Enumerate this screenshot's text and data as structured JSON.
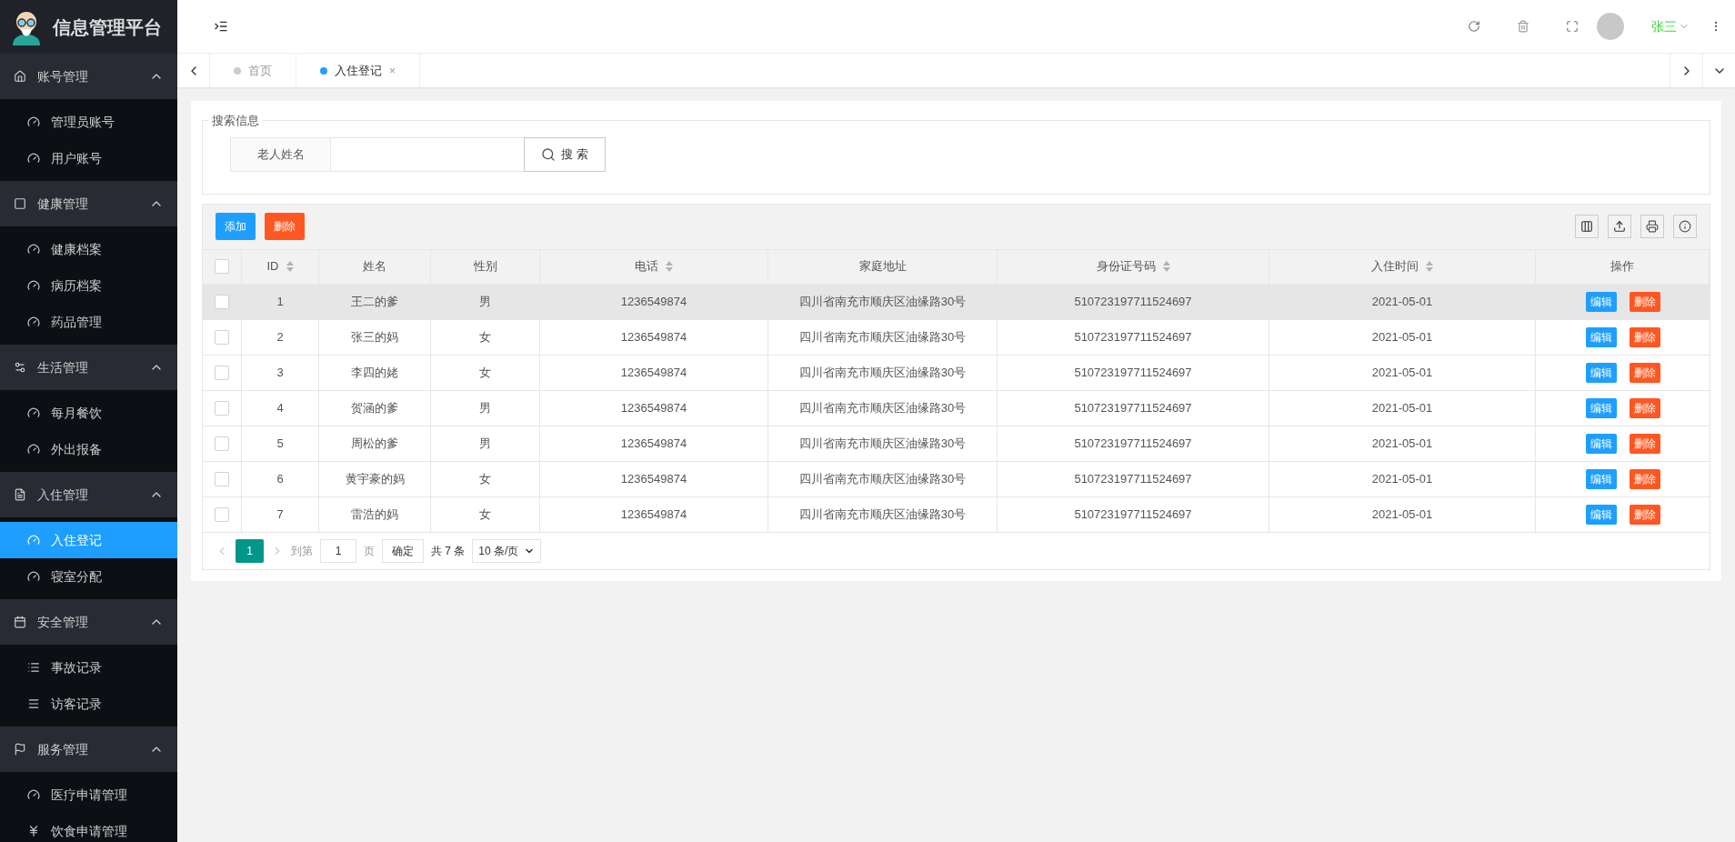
{
  "brand": {
    "title": "信息管理平台"
  },
  "header": {
    "user": "张三"
  },
  "sidebar": {
    "groups": [
      {
        "label": "账号管理",
        "expanded": true,
        "items": [
          {
            "label": "管理员账号",
            "selected": false
          },
          {
            "label": "用户账号",
            "selected": false
          }
        ]
      },
      {
        "label": "健康管理",
        "expanded": true,
        "items": [
          {
            "label": "健康档案",
            "selected": false
          },
          {
            "label": "病历档案",
            "selected": false
          },
          {
            "label": "药品管理",
            "selected": false
          }
        ]
      },
      {
        "label": "生活管理",
        "expanded": true,
        "items": [
          {
            "label": "每月餐饮",
            "selected": false
          },
          {
            "label": "外出报备",
            "selected": false
          }
        ]
      },
      {
        "label": "入住管理",
        "expanded": true,
        "items": [
          {
            "label": "入住登记",
            "selected": true
          },
          {
            "label": "寝室分配",
            "selected": false
          }
        ]
      },
      {
        "label": "安全管理",
        "expanded": true,
        "items": [
          {
            "label": "事故记录",
            "selected": false
          },
          {
            "label": "访客记录",
            "selected": false
          }
        ]
      },
      {
        "label": "服务管理",
        "expanded": true,
        "items": [
          {
            "label": "医疗申请管理",
            "selected": false
          },
          {
            "label": "饮食申请管理",
            "selected": false
          }
        ]
      }
    ]
  },
  "tabs": [
    {
      "label": "首页",
      "selected": false
    },
    {
      "label": "入住登记",
      "selected": true,
      "close": "×"
    }
  ],
  "search": {
    "legend": "搜索信息",
    "field_label": "老人姓名",
    "button": "搜 索"
  },
  "toolbar": {
    "buttons": [
      {
        "label": "添加",
        "kind": "primary"
      },
      {
        "label": "删除",
        "kind": "danger"
      }
    ]
  },
  "table": {
    "select_all_checked": false,
    "columns": [
      {
        "label": "ID",
        "sortable": true
      },
      {
        "label": "姓名",
        "sortable": false
      },
      {
        "label": "性别",
        "sortable": false
      },
      {
        "label": "电话",
        "sortable": true
      },
      {
        "label": "家庭地址",
        "sortable": false
      },
      {
        "label": "身份证号码",
        "sortable": true
      },
      {
        "label": "入住时间",
        "sortable": true
      },
      {
        "label": "操作",
        "sortable": false
      }
    ],
    "rows": [
      {
        "checked": false,
        "highlighted": true,
        "cells": [
          "1",
          "王二的爹",
          "男",
          "1236549874",
          "四川省南充市顺庆区油缘路30号",
          "510723197711524697",
          "2021-05-01"
        ],
        "actions": [
          "编辑",
          "删除"
        ]
      },
      {
        "checked": false,
        "highlighted": false,
        "cells": [
          "2",
          "张三的妈",
          "女",
          "1236549874",
          "四川省南充市顺庆区油缘路30号",
          "510723197711524697",
          "2021-05-01"
        ],
        "actions": [
          "编辑",
          "删除"
        ]
      },
      {
        "checked": false,
        "highlighted": false,
        "cells": [
          "3",
          "李四的姥",
          "女",
          "1236549874",
          "四川省南充市顺庆区油缘路30号",
          "510723197711524697",
          "2021-05-01"
        ],
        "actions": [
          "编辑",
          "删除"
        ]
      },
      {
        "checked": false,
        "highlighted": false,
        "cells": [
          "4",
          "贺涵的爹",
          "男",
          "1236549874",
          "四川省南充市顺庆区油缘路30号",
          "510723197711524697",
          "2021-05-01"
        ],
        "actions": [
          "编辑",
          "删除"
        ]
      },
      {
        "checked": false,
        "highlighted": false,
        "cells": [
          "5",
          "周松的爹",
          "男",
          "1236549874",
          "四川省南充市顺庆区油缘路30号",
          "510723197711524697",
          "2021-05-01"
        ],
        "actions": [
          "编辑",
          "删除"
        ]
      },
      {
        "checked": false,
        "highlighted": false,
        "cells": [
          "6",
          "黄宇豪的妈",
          "女",
          "1236549874",
          "四川省南充市顺庆区油缘路30号",
          "510723197711524697",
          "2021-05-01"
        ],
        "actions": [
          "编辑",
          "删除"
        ]
      },
      {
        "checked": false,
        "highlighted": false,
        "cells": [
          "7",
          "雷浩的妈",
          "女",
          "1236549874",
          "四川省南充市顺庆区油缘路30号",
          "510723197711524697",
          "2021-05-01"
        ],
        "actions": [
          "编辑",
          "删除"
        ]
      }
    ]
  },
  "pagination": {
    "pages": [
      {
        "label": "1",
        "selected": true
      }
    ],
    "goto_label": "到第",
    "page_value": "1",
    "page_unit": "页",
    "confirm": "确定",
    "total": "共 7 条",
    "page_size": "10 条/页"
  }
}
